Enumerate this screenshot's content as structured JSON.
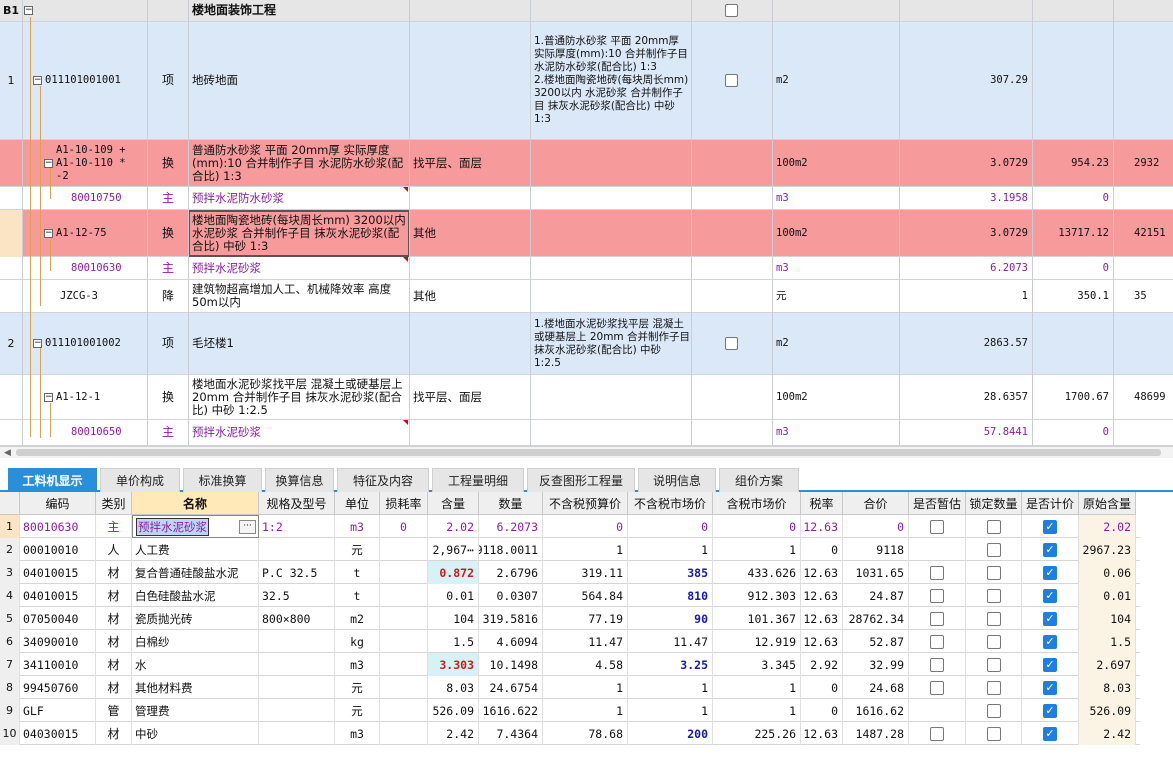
{
  "top_header": {
    "section": "B1",
    "expand": "−",
    "title": "楼地面装饰工程"
  },
  "top_rows": [
    {
      "no": "1",
      "code": "011101001001",
      "type": "项",
      "name": "地砖地面",
      "spec": "",
      "feature": "1.普通防水砂浆 平面 20mm厚 实际厚度(mm):10 合并制作子目 水泥防水砂浆(配合比) 1:3\n2.楼地面陶瓷地砖(每块周长mm) 3200以内 水泥砂浆 合并制作子目 抹灰水泥砂浆(配合比) 中砂 1:3",
      "unit": "m2",
      "qty": "307.29",
      "price": "",
      "total": ""
    },
    {
      "no": "",
      "code": "A1-10-109 +\nA1-10-110 *\n-2",
      "type": "换",
      "name": "普通防水砂浆 平面 20mm厚 实际厚度(mm):10 合并制作子目 水泥防水砂浆(配合比) 1:3",
      "spec": "找平层、面层",
      "feature": "",
      "unit": "100m2",
      "qty": "3.0729",
      "price": "954.23",
      "total": "2932"
    },
    {
      "no": "",
      "code": "80010750",
      "type": "主",
      "name": "预拌水泥防水砂浆",
      "spec": "",
      "feature": "",
      "unit": "m3",
      "qty": "3.1958",
      "price": "0",
      "total": ""
    },
    {
      "no": "",
      "code": "A1-12-75",
      "type": "换",
      "name": "楼地面陶瓷地砖(每块周长mm) 3200以内 水泥砂浆 合并制作子目 抹灰水泥砂浆(配合比) 中砂 1:3",
      "spec": "其他",
      "feature": "",
      "unit": "100m2",
      "qty": "3.0729",
      "price": "13717.12",
      "total": "42151"
    },
    {
      "no": "",
      "code": "80010630",
      "type": "主",
      "name": "预拌水泥砂浆",
      "spec": "",
      "feature": "",
      "unit": "m3",
      "qty": "6.2073",
      "price": "0",
      "total": ""
    },
    {
      "no": "",
      "code": "JZCG-3",
      "type": "降",
      "name": "建筑物超高增加人工、机械降效率 高度50m以内",
      "spec": "其他",
      "feature": "",
      "unit": "元",
      "qty": "1",
      "price": "350.1",
      "total": "35"
    },
    {
      "no": "2",
      "code": "011101001002",
      "type": "项",
      "name": "毛坯楼1",
      "spec": "",
      "feature": "1.楼地面水泥砂浆找平层 混凝土或硬基层上 20mm 合并制作子目 抹灰水泥砂浆(配合比) 中砂 1:2.5",
      "unit": "m2",
      "qty": "2863.57",
      "price": "",
      "total": ""
    },
    {
      "no": "",
      "code": "A1-12-1",
      "type": "换",
      "name": "楼地面水泥砂浆找平层 混凝土或硬基层上 20mm 合并制作子目 抹灰水泥砂浆(配合比) 中砂 1:2.5",
      "spec": "找平层、面层",
      "feature": "",
      "unit": "100m2",
      "qty": "28.6357",
      "price": "1700.67",
      "total": "48699"
    },
    {
      "no": "",
      "code": "80010650",
      "type": "主",
      "name": "预拌水泥砂浆",
      "spec": "",
      "feature": "",
      "unit": "m3",
      "qty": "57.8441",
      "price": "0",
      "total": ""
    }
  ],
  "tabs": [
    "工料机显示",
    "单价构成",
    "标准换算",
    "换算信息",
    "特征及内容",
    "工程量明细",
    "反查图形工程量",
    "说明信息",
    "组价方案"
  ],
  "columns": [
    "编码",
    "类别",
    "名称",
    "规格及型号",
    "单位",
    "损耗率",
    "含量",
    "数量",
    "不含税预算价",
    "不含税市场价",
    "含税市场价",
    "税率",
    "合价",
    "是否暂估",
    "锁定数量",
    "是否计价",
    "原始含量"
  ],
  "rows": [
    {
      "no": "1",
      "code": "80010630",
      "cat": "主",
      "name": "预拌水泥砂浆",
      "spec": "1:2",
      "unit": "m3",
      "loss": "0",
      "content": "2.02",
      "qty": "6.2073",
      "budget": "0",
      "market": "0",
      "taxed": "0",
      "rate": "12.63",
      "total": "0",
      "est": false,
      "lock": false,
      "priced": true,
      "orig": "2.02"
    },
    {
      "no": "2",
      "code": "00010010",
      "cat": "人",
      "name": "人工费",
      "spec": "",
      "unit": "元",
      "loss": "",
      "content": "2,967⋯",
      "qty": "9118.0011",
      "budget": "1",
      "market": "1",
      "taxed": "1",
      "rate": "0",
      "total": "9118",
      "est": null,
      "lock": false,
      "priced": true,
      "orig": "2967.23"
    },
    {
      "no": "3",
      "code": "04010015",
      "cat": "材",
      "name": "复合普通硅酸盐水泥",
      "spec": "P.C 32.5",
      "unit": "t",
      "loss": "",
      "content": "0.872",
      "qty": "2.6796",
      "budget": "319.11",
      "market": "385",
      "taxed": "433.626",
      "rate": "12.63",
      "total": "1031.65",
      "est": false,
      "lock": false,
      "priced": true,
      "orig": "0.06"
    },
    {
      "no": "4",
      "code": "04010015",
      "cat": "材",
      "name": "白色硅酸盐水泥",
      "spec": "32.5",
      "unit": "t",
      "loss": "",
      "content": "0.01",
      "qty": "0.0307",
      "budget": "564.84",
      "market": "810",
      "taxed": "912.303",
      "rate": "12.63",
      "total": "24.87",
      "est": false,
      "lock": false,
      "priced": true,
      "orig": "0.01"
    },
    {
      "no": "5",
      "code": "07050040",
      "cat": "材",
      "name": "瓷质抛光砖",
      "spec": "800×800",
      "unit": "m2",
      "loss": "",
      "content": "104",
      "qty": "319.5816",
      "budget": "77.19",
      "market": "90",
      "taxed": "101.367",
      "rate": "12.63",
      "total": "28762.34",
      "est": false,
      "lock": false,
      "priced": true,
      "orig": "104"
    },
    {
      "no": "6",
      "code": "34090010",
      "cat": "材",
      "name": "白棉纱",
      "spec": "",
      "unit": "kg",
      "loss": "",
      "content": "1.5",
      "qty": "4.6094",
      "budget": "11.47",
      "market": "11.47",
      "taxed": "12.919",
      "rate": "12.63",
      "total": "52.87",
      "est": false,
      "lock": false,
      "priced": true,
      "orig": "1.5"
    },
    {
      "no": "7",
      "code": "34110010",
      "cat": "材",
      "name": "水",
      "spec": "",
      "unit": "m3",
      "loss": "",
      "content": "3.303",
      "qty": "10.1498",
      "budget": "4.58",
      "market": "3.25",
      "taxed": "3.345",
      "rate": "2.92",
      "total": "32.99",
      "est": false,
      "lock": false,
      "priced": true,
      "orig": "2.697"
    },
    {
      "no": "8",
      "code": "99450760",
      "cat": "材",
      "name": "其他材料费",
      "spec": "",
      "unit": "元",
      "loss": "",
      "content": "8.03",
      "qty": "24.6754",
      "budget": "1",
      "market": "1",
      "taxed": "1",
      "rate": "0",
      "total": "24.68",
      "est": false,
      "lock": false,
      "priced": true,
      "orig": "8.03"
    },
    {
      "no": "9",
      "code": "GLF",
      "cat": "管",
      "name": "管理费",
      "spec": "",
      "unit": "元",
      "loss": "",
      "content": "526.09",
      "qty": "1616.622",
      "budget": "1",
      "market": "1",
      "taxed": "1",
      "rate": "0",
      "total": "1616.62",
      "est": null,
      "lock": false,
      "priced": true,
      "orig": "526.09"
    },
    {
      "no": "10",
      "code": "04030015",
      "cat": "材",
      "name": "中砂",
      "spec": "",
      "unit": "m3",
      "loss": "",
      "content": "2.42",
      "qty": "7.4364",
      "budget": "78.68",
      "market": "200",
      "taxed": "225.26",
      "rate": "12.63",
      "total": "1487.28",
      "est": false,
      "lock": false,
      "priced": true,
      "orig": "2.42"
    }
  ],
  "colors": {
    "item_row": "#dbe8f8",
    "sub_row": "#f69a9c",
    "tab_active": "#2a8fd9",
    "main_text": "#8c1aa6"
  }
}
